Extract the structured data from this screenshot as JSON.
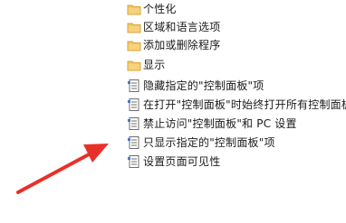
{
  "tree": {
    "folders": [
      {
        "label": "个性化",
        "icon": "folder-icon"
      },
      {
        "label": "区域和语言选项",
        "icon": "folder-icon"
      },
      {
        "label": "添加或删除程序",
        "icon": "folder-icon"
      },
      {
        "label": "显示",
        "icon": "folder-icon"
      }
    ],
    "policies": [
      {
        "label": "隐藏指定的\"控制面板\"项",
        "icon": "policy-setting-icon"
      },
      {
        "label": "在打开\"控制面板\"时始终打开所有控制面板",
        "icon": "policy-setting-icon"
      },
      {
        "label": "禁止访问\"控制面板\"和 PC 设置",
        "icon": "policy-setting-icon"
      },
      {
        "label": "只显示指定的\"控制面板\"项",
        "icon": "policy-setting-icon"
      },
      {
        "label": "设置页面可见性",
        "icon": "policy-setting-icon"
      }
    ]
  },
  "annotation": {
    "icon": "red-arrow-icon",
    "color": "#e8302a"
  },
  "colors": {
    "folder": "#f2c35a",
    "folder_dark": "#d9a53a",
    "policy_border": "#6d6d6d"
  }
}
